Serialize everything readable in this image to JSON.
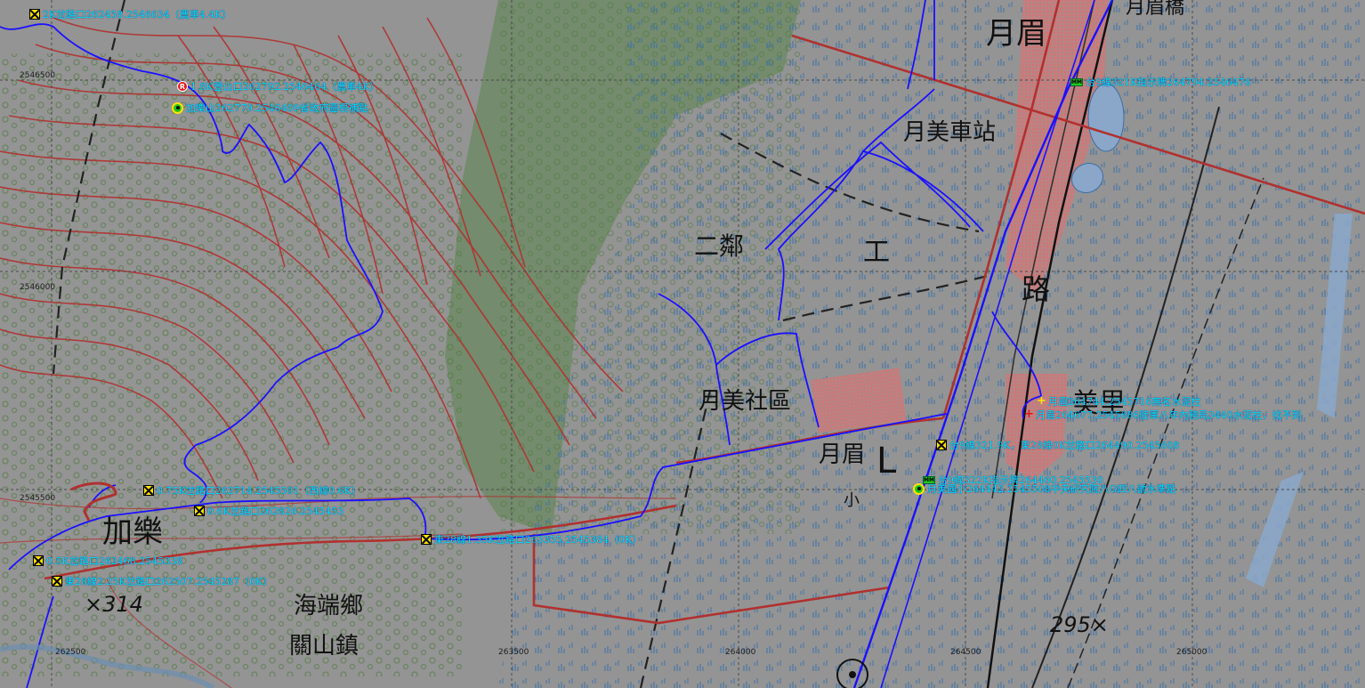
{
  "map": {
    "colors": {
      "background": "#929292",
      "contour": "#b0312f",
      "track": "#1a10ff",
      "grid": "#4a4a4a",
      "road": "#b0312f",
      "label": "#00e5ff",
      "urban": "#c96a6a",
      "forest": "#6e8a64"
    },
    "places": [
      {
        "id": "yuemei-big",
        "text": "月眉"
      },
      {
        "id": "yuemei-station",
        "text": "月美車站"
      },
      {
        "id": "erlin",
        "text": "二鄰"
      },
      {
        "id": "gong",
        "text": "工"
      },
      {
        "id": "lu",
        "text": "路"
      },
      {
        "id": "yuemei-community",
        "text": "月美社區"
      },
      {
        "id": "yuemei-small",
        "text": "月眉"
      },
      {
        "id": "jiale",
        "text": "加樂"
      },
      {
        "id": "haiduan",
        "text": "海端鄉"
      },
      {
        "id": "guanshan",
        "text": "關山鎮"
      },
      {
        "id": "elev-314",
        "text": "×314"
      },
      {
        "id": "elev-295",
        "text": "295×"
      },
      {
        "id": "xiao",
        "text": "小"
      },
      {
        "id": "meili",
        "text": "美里"
      },
      {
        "id": "yuemeiqiao",
        "text": "月眉橋"
      },
      {
        "id": "l-mark",
        "text": "L"
      }
    ],
    "grid_labels": {
      "y": [
        "2546500",
        "2546000",
        "2545500"
      ],
      "x": [
        "262500",
        "263500",
        "264000",
        "264500",
        "265000"
      ]
    },
    "waypoints": [
      {
        "icon": "x",
        "label": "2K岔路口262458.2546634（農車4.4K）"
      },
      {
        "icon": "r",
        "label": "1.8K登山口262792.2546464（農車4K）"
      },
      {
        "icon": "target",
        "label": "加樂山262779.2546409省政府圖根補點"
      },
      {
        "icon": "mm",
        "label": "台9線321K指示牌264794.2546476"
      },
      {
        "icon": "plus",
        "label": "月眉264744.2545716無名水泥柱"
      },
      {
        "icon": "redplus",
        "label": "月眉264677.2545686陸軍八年內務局3440水泥柱，找不到"
      },
      {
        "icon": "x",
        "label": "台9線321.9K，東28線0K岔路口264490.2545608"
      },
      {
        "icon": "mm",
        "label": "台9線322K指示牌264460.2545530"
      },
      {
        "icon": "target",
        "label": "月美國小264442.2545508中央研究院八O四八號水準點"
      },
      {
        "icon": "x",
        "label": "0.75K岔路口262714.2545501（西線0.6K）"
      },
      {
        "icon": "x",
        "label": "0.6K岔路口262826.2545453"
      },
      {
        "icon": "x",
        "label": "東28線1.35K岔路口263355.2545384（0K）"
      },
      {
        "icon": "x",
        "label": "0.5K岔路口262468.2545338"
      },
      {
        "icon": "x",
        "label": "東28線2.25K岔路口262507.2545287（0K）"
      }
    ]
  }
}
